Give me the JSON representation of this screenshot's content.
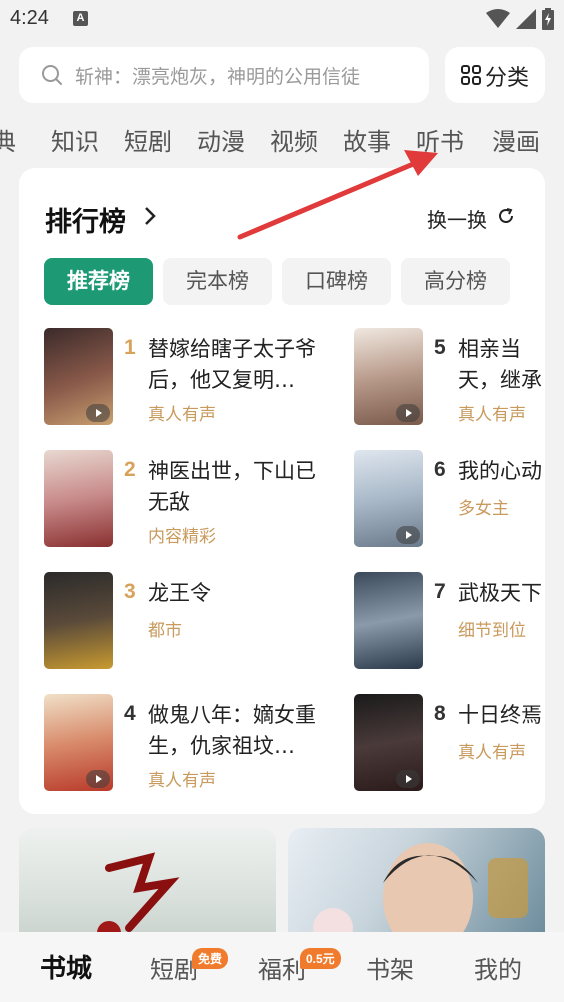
{
  "status": {
    "time": "4:24",
    "notif_letter": "A"
  },
  "search": {
    "placeholder": "斩神：漂亮炮灰，神明的公用信徒"
  },
  "category_button": {
    "label": "分类"
  },
  "tabs": [
    "典",
    "知识",
    "短剧",
    "动漫",
    "视频",
    "故事",
    "听书",
    "漫画"
  ],
  "ranking": {
    "title": "排行榜",
    "refresh_label": "换一换",
    "tabs": [
      {
        "label": "推荐榜",
        "active": true
      },
      {
        "label": "完本榜",
        "active": false
      },
      {
        "label": "口碑榜",
        "active": false
      },
      {
        "label": "高分榜",
        "active": false
      }
    ],
    "books": [
      {
        "rank": "1",
        "title": "替嫁给瞎子太子爷后，他又复明…",
        "tag": "真人有声",
        "audio": true
      },
      {
        "rank": "2",
        "title": "神医出世，下山已无敌",
        "tag": "内容精彩",
        "audio": false
      },
      {
        "rank": "3",
        "title": "龙王令",
        "tag": "都市",
        "audio": false
      },
      {
        "rank": "4",
        "title": "做鬼八年：嫡女重生，仇家祖坟…",
        "tag": "真人有声",
        "audio": true
      },
      {
        "rank": "5",
        "title": "相亲当天，继承人挂",
        "tag": "真人有声",
        "audio": true
      },
      {
        "rank": "6",
        "title": "我的心动",
        "tag": "多女主",
        "audio": true
      },
      {
        "rank": "7",
        "title": "武极天下",
        "tag": "细节到位",
        "audio": false
      },
      {
        "rank": "8",
        "title": "十日终焉",
        "tag": "真人有声",
        "audio": true
      }
    ]
  },
  "bottom_nav": [
    {
      "label": "书城",
      "active": true,
      "badge": ""
    },
    {
      "label": "短剧",
      "active": false,
      "badge": "免费"
    },
    {
      "label": "福利",
      "active": false,
      "badge": "0.5元"
    },
    {
      "label": "书架",
      "active": false,
      "badge": ""
    },
    {
      "label": "我的",
      "active": false,
      "badge": ""
    }
  ],
  "colors": {
    "accent": "#1d9a74",
    "rank_top": "#d8a25a",
    "tag": "#c99a5d",
    "badge": "#f07b2c"
  }
}
